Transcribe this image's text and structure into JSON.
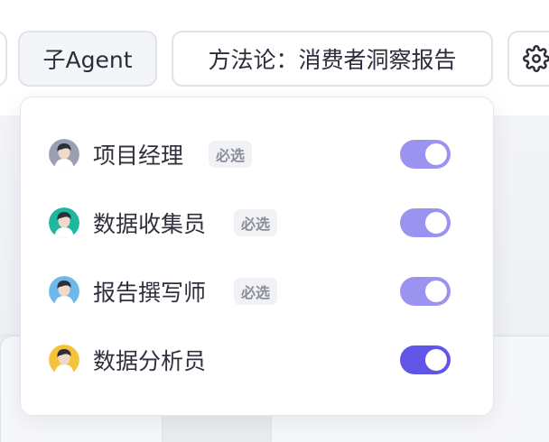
{
  "toolbar": {
    "agent_chip_label": "子Agent",
    "method_chip_label": "方法论：消费者洞察报告",
    "settings_icon": "gear-icon"
  },
  "agents": {
    "required_badge": "必选",
    "items": [
      {
        "name": "项目经理",
        "required": true,
        "enabled": true,
        "avatar_color": "#9aa0b4",
        "toggle_color": "#9a93ef"
      },
      {
        "name": "数据收集员",
        "required": true,
        "enabled": true,
        "avatar_color": "#1fb7a0",
        "toggle_color": "#9a93ef"
      },
      {
        "name": "报告撰写师",
        "required": true,
        "enabled": true,
        "avatar_color": "#6fb8ea",
        "toggle_color": "#9a93ef"
      },
      {
        "name": "数据分析员",
        "required": false,
        "enabled": true,
        "avatar_color": "#f5c33b",
        "toggle_color": "#6155e8"
      }
    ]
  }
}
